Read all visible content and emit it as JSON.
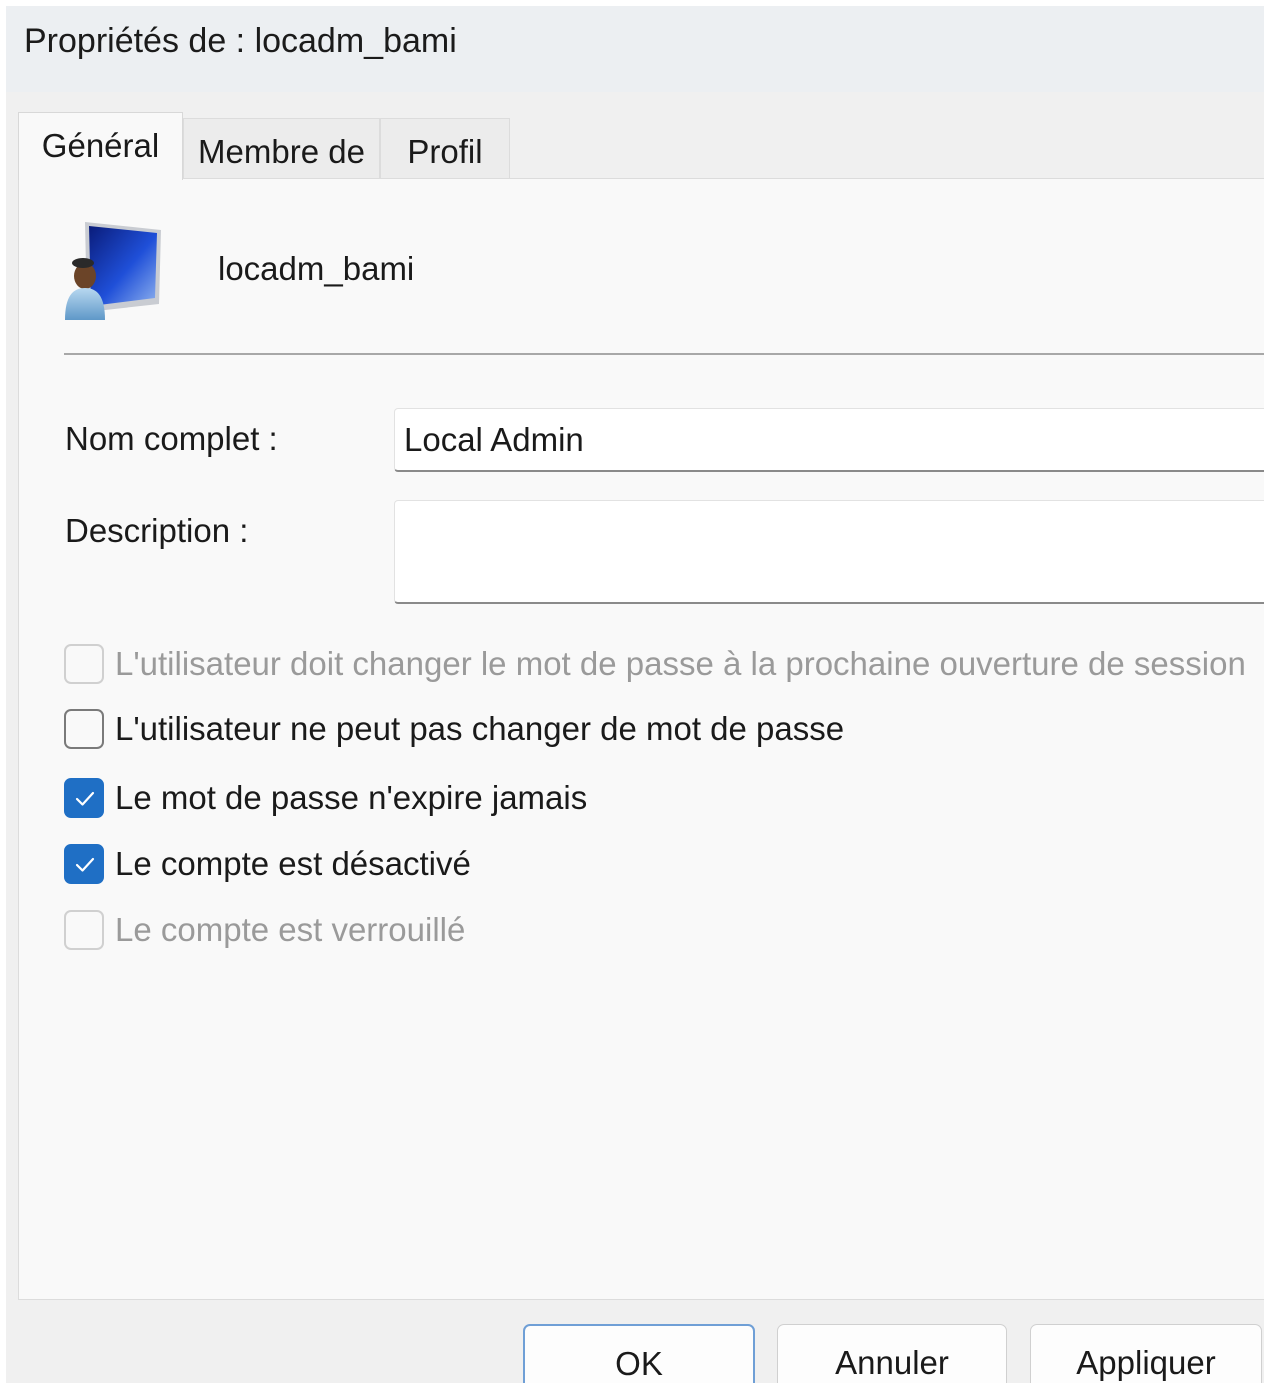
{
  "window": {
    "title": "Propriétés de : locadm_bami"
  },
  "tabs": [
    {
      "label": "Général",
      "active": true
    },
    {
      "label": "Membre de",
      "active": false
    },
    {
      "label": "Profil",
      "active": false
    }
  ],
  "general": {
    "user_icon": "user-account-icon",
    "username": "locadm_bami",
    "full_name": {
      "label": "Nom complet :",
      "value": "Local Admin"
    },
    "description": {
      "label": "Description :",
      "value": ""
    },
    "checkboxes": [
      {
        "label": "L'utilisateur doit changer le mot de passe à la prochaine ouverture de session",
        "checked": false,
        "enabled": false
      },
      {
        "label": "L'utilisateur ne peut pas changer de mot de passe",
        "checked": false,
        "enabled": true
      },
      {
        "label": "Le mot de passe n'expire jamais",
        "checked": true,
        "enabled": true
      },
      {
        "label": "Le compte est désactivé",
        "checked": true,
        "enabled": true
      },
      {
        "label": "Le compte est verrouillé",
        "checked": false,
        "enabled": false
      }
    ]
  },
  "buttons": {
    "ok": "OK",
    "cancel": "Annuler",
    "apply": "Appliquer"
  },
  "colors": {
    "accent": "#1f6fc5",
    "disabled_text": "#9a9a9a"
  }
}
